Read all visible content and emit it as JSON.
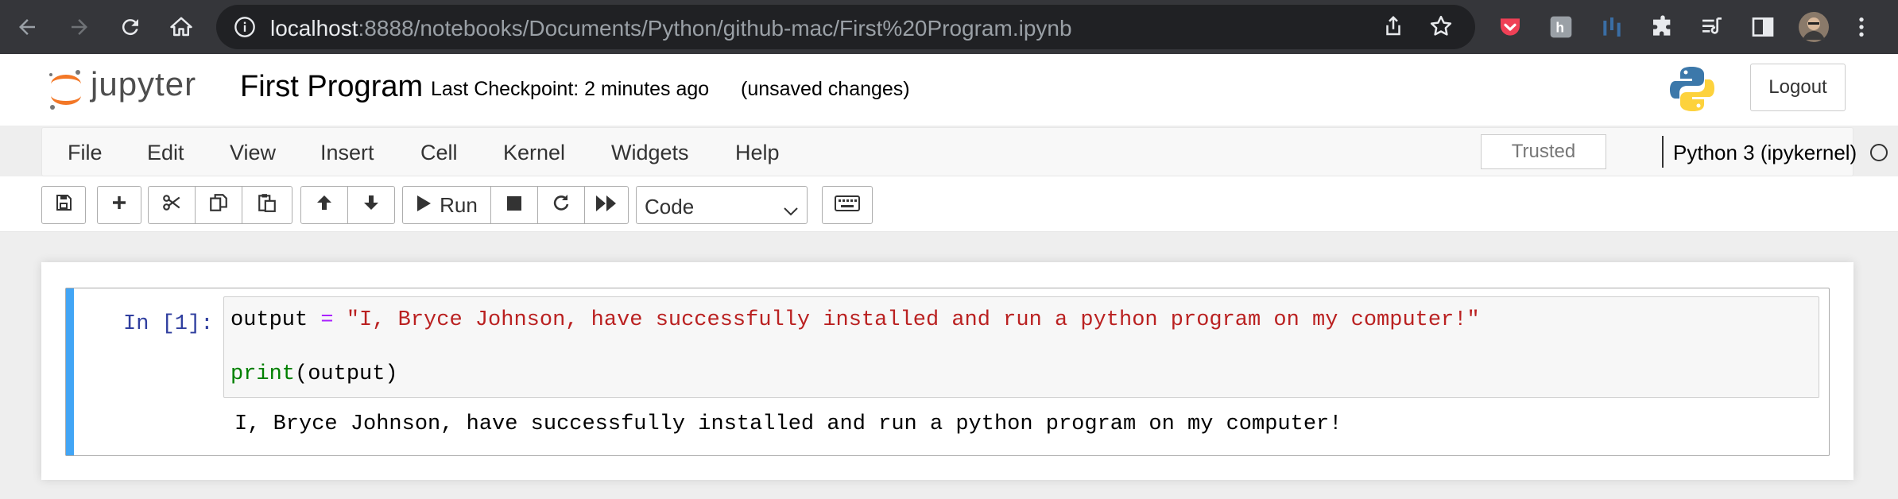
{
  "browser": {
    "url_host": "localhost",
    "url_rest": ":8888/notebooks/Documents/Python/github-mac/First%20Program.ipynb"
  },
  "header": {
    "logo_text": "jupyter",
    "notebook_title": "First Program",
    "checkpoint": "Last Checkpoint: 2 minutes ago",
    "unsaved": "(unsaved changes)",
    "logout_label": "Logout"
  },
  "menu": {
    "items": [
      "File",
      "Edit",
      "View",
      "Insert",
      "Cell",
      "Kernel",
      "Widgets",
      "Help"
    ],
    "trusted_label": "Trusted",
    "kernel_name": "Python 3 (ipykernel)"
  },
  "toolbar": {
    "run_label": "Run",
    "cell_type": "Code",
    "cell_type_options": [
      "Code"
    ]
  },
  "cell": {
    "prompt": "In [1]:",
    "code": {
      "line1_var": "output",
      "line1_op": "=",
      "line1_str": "\"I, Bryce Johnson, have successfully installed and run a python program on my computer!\"",
      "line2_builtin": "print",
      "line2_rest": "(output)"
    },
    "output": "I, Bryce Johnson, have successfully installed and run a python program on my computer!"
  },
  "colors": {
    "accent_cell_bar": "#42a5f5",
    "prompt": "#303f9f",
    "string": "#ba2121",
    "builtin": "#008000",
    "operator": "#aa22ff"
  }
}
